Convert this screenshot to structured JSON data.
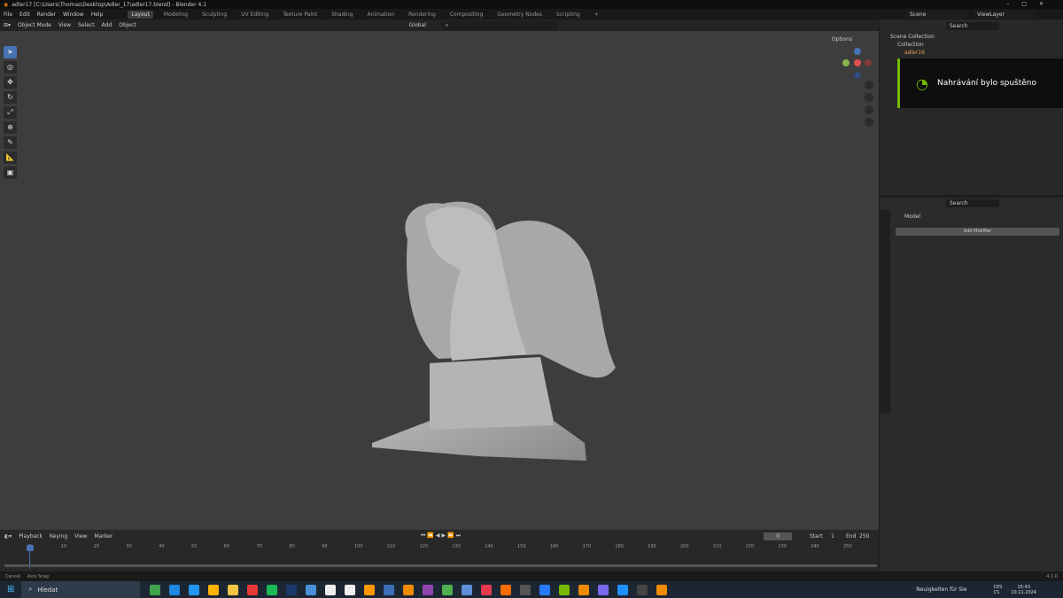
{
  "window": {
    "title": "adler17 [C:\\Users\\Thomas\\Desktop\\Adler_17\\adler17.blend] - Blender 4.1"
  },
  "menu": [
    "File",
    "Edit",
    "Render",
    "Window",
    "Help"
  ],
  "workspaces": [
    "Layout",
    "Modeling",
    "Sculpting",
    "UV Editing",
    "Texture Paint",
    "Shading",
    "Animation",
    "Rendering",
    "Compositing",
    "Geometry Nodes",
    "Scripting",
    "+"
  ],
  "viewport_header": {
    "mode": "Object Mode",
    "menus": [
      "View",
      "Select",
      "Add",
      "Object"
    ],
    "orientation": "Global",
    "options": "Options"
  },
  "outliner": {
    "scene": "Scene",
    "view_layer": "ViewLayer",
    "search_placeholder": "Search",
    "items": [
      "Scene Collection",
      "Collection",
      "adler16"
    ]
  },
  "notification": {
    "text": "Nahrávání bylo spuštěno",
    "accent": "#76b900"
  },
  "properties": {
    "search_placeholder": "Search",
    "object": "Model",
    "add_modifier": "Add Modifier"
  },
  "timeline": {
    "menus": [
      "Playback",
      "Keying",
      "View",
      "Marker"
    ],
    "current_frame": "0",
    "start_label": "Start",
    "start": "1",
    "end_label": "End",
    "end": "250",
    "ticks": [
      "0",
      "10",
      "20",
      "30",
      "40",
      "50",
      "60",
      "70",
      "80",
      "90",
      "100",
      "110",
      "120",
      "130",
      "140",
      "150",
      "160",
      "170",
      "180",
      "190",
      "200",
      "210",
      "220",
      "230",
      "240",
      "250"
    ]
  },
  "status": {
    "items": [
      "Cancel",
      "Axis Snap"
    ],
    "version": "4.1.0"
  },
  "taskbar": {
    "search": "Hledat",
    "news": "Neuigkeiten für Sie",
    "lang1": "CES",
    "lang2": "CS",
    "time": "15:43",
    "date": "10.11.2024"
  },
  "colors": {
    "accent": "#4772b3",
    "viewport": "#3d3d3d"
  }
}
